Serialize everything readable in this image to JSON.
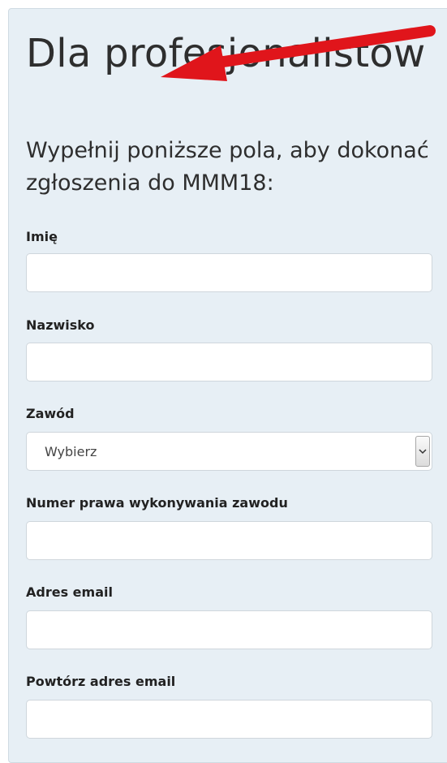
{
  "header": {
    "title": "Dla profesjonalistów",
    "subtitle": "Wypełnij poniższe pola, aby dokonać zgłoszenia do MMM18:"
  },
  "form": {
    "first_name_label": "Imię",
    "last_name_label": "Nazwisko",
    "profession_label": "Zawód",
    "profession_value": "Wybierz",
    "license_label": "Numer prawa wykonywania zawodu",
    "email_label": "Adres email",
    "email_repeat_label": "Powtórz adres email"
  },
  "colors": {
    "panel_bg": "#e7eff5",
    "annotation_arrow": "#e0151b"
  },
  "icons": {
    "annotation": "red-arrow-icon",
    "dropdown": "chevron-down-icon"
  }
}
